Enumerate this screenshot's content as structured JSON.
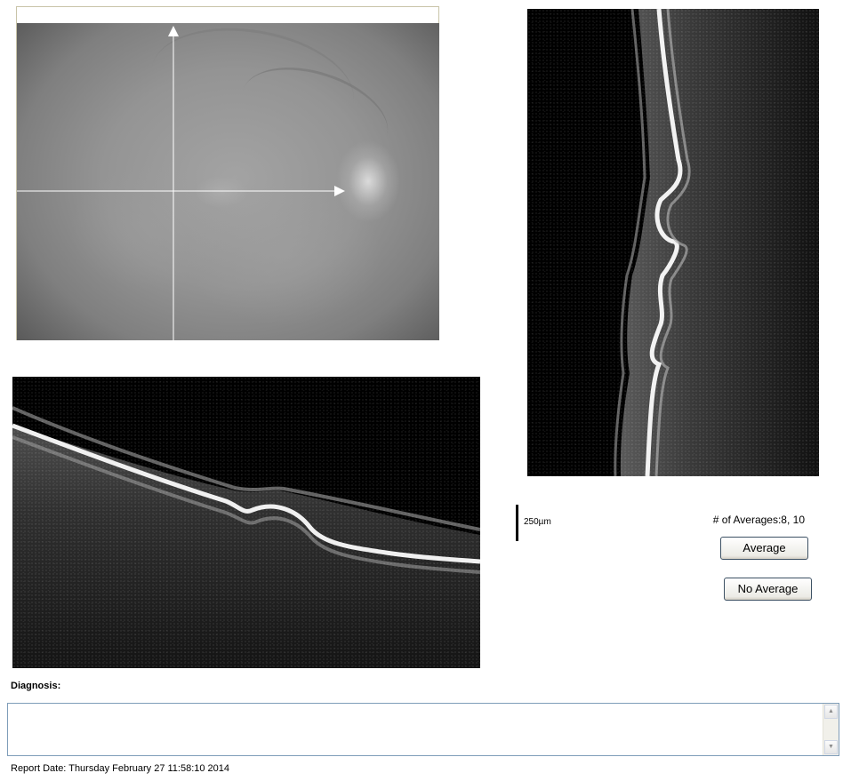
{
  "scale_bar": {
    "label": "250µm"
  },
  "averages": {
    "label": "# of Averages:8, 10",
    "average_button": "Average",
    "no_average_button": "No Average"
  },
  "diagnosis": {
    "label": "Diagnosis:",
    "value": ""
  },
  "report": {
    "date_text": "Report Date: Thursday February 27 11:58:10 2014"
  },
  "icons": {
    "scroll_up": "scroll-up-arrow-icon",
    "scroll_down": "scroll-down-arrow-icon"
  }
}
